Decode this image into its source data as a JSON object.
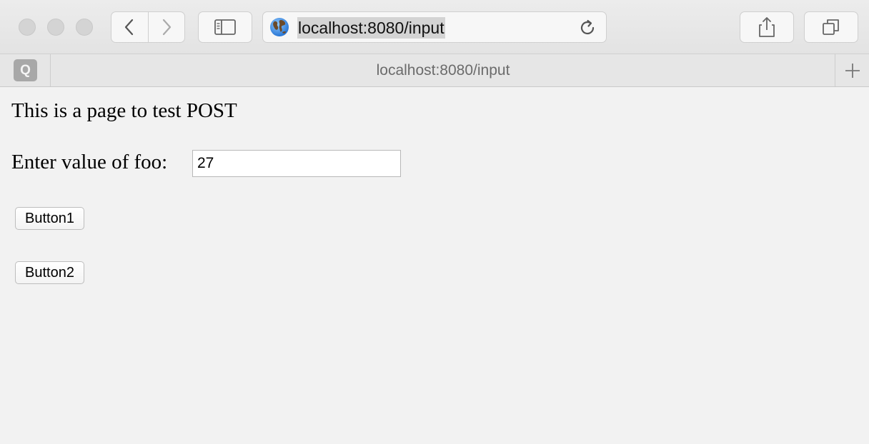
{
  "browser": {
    "url": "localhost:8080/input",
    "tab_title": "localhost:8080/input",
    "tab_icon_letter": "Q"
  },
  "page": {
    "heading": "This is a page to test POST",
    "foo_label": "Enter value of foo:",
    "foo_value": "27",
    "button1_label": "Button1",
    "button2_label": "Button2"
  }
}
